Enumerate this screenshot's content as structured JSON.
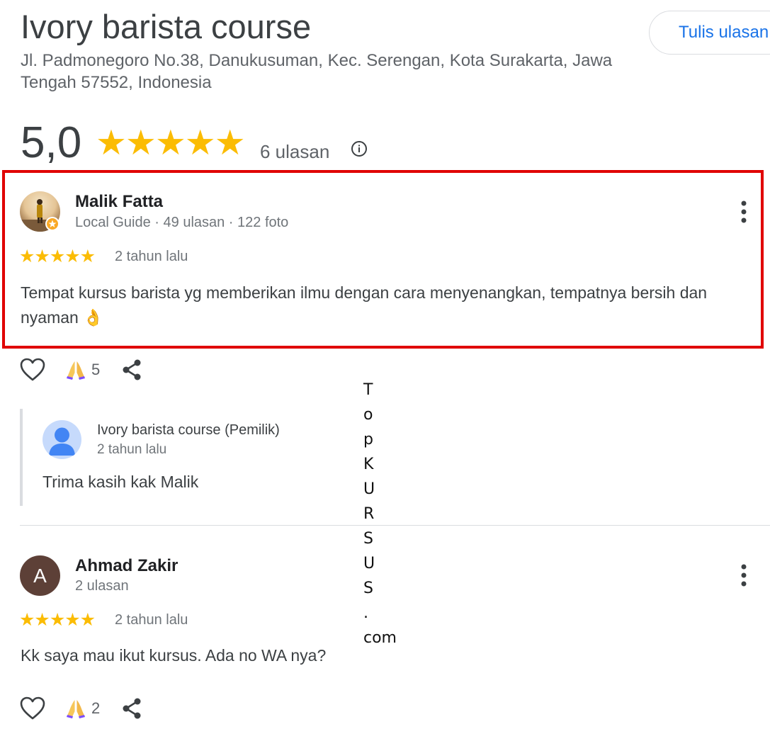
{
  "place": {
    "name": "Ivory barista course",
    "address": "Jl. Padmonegoro No.38, Danukusuman, Kec. Serengan, Kota Surakarta, Jawa Tengah 57552, Indonesia",
    "write_review_label": "Tulis ulasan",
    "rating": "5,0",
    "rating_stars": "★★★★★",
    "rating_value": 5.0,
    "review_count": "6 ulasan",
    "star_color": "#fbbc04",
    "link_color": "#1a73e8"
  },
  "reviews": [
    {
      "name": "Malik Fatta",
      "meta": "Local Guide · 49 ulasan · 122 foto",
      "stars": "★★★★★",
      "rating_value": 5,
      "time": "2 tahun lalu",
      "text": "Tempat kursus barista yg memberikan ilmu dengan cara menyenangkan, tempatnya bersih dan nyaman 👌",
      "reaction_count": "5",
      "highlight_color": "#e00000",
      "owner_reply": {
        "name": "Ivory barista course (Pemilik)",
        "time": "2 tahun lalu",
        "text": "Trima kasih kak Malik"
      }
    },
    {
      "name": "Ahmad Zakir",
      "initial": "A",
      "avatar_color": "#5d4037",
      "meta": "2 ulasan",
      "stars": "★★★★★",
      "rating_value": 5,
      "time": "2 tahun lalu",
      "text": "Kk saya mau ikut kursus. Ada no WA nya?",
      "reaction_count": "2"
    }
  ],
  "icons": {
    "info": "info-icon",
    "more": "more-vert-icon",
    "like": "heart-icon",
    "reaction": "praying-hands-icon",
    "share": "share-icon"
  },
  "watermark": {
    "chars": [
      "T",
      "o",
      "p",
      "K",
      "U",
      "R",
      "S",
      "U",
      "S",
      ".",
      "com"
    ]
  }
}
